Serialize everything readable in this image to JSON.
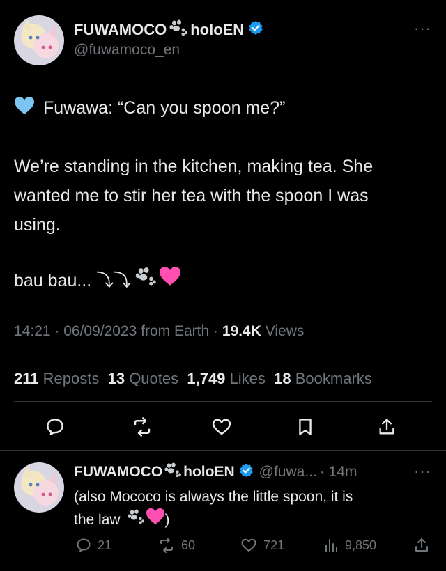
{
  "tweet": {
    "author_name_part1": "FUWAMOCO",
    "author_name_part2": "holoEN",
    "handle": "@fuwamoco_en",
    "more_label": "···",
    "line1": "Fuwawa: “Can you spoon me?”",
    "para2_line1": "We’re standing in the kitchen, making tea. She",
    "para2_line2": "wanted me to stir her tea with the spoon I was",
    "para2_line3": "using.",
    "line4": "bau bau... ⤵⤵",
    "meta_time": "14:21 · 06/09/2023 from Earth · ",
    "meta_views_num": "19.4K",
    "meta_views_label": " Views",
    "stats": [
      {
        "num": "211",
        "label": "Reposts"
      },
      {
        "num": "13",
        "label": "Quotes"
      },
      {
        "num": "1,749",
        "label": "Likes"
      },
      {
        "num": "18",
        "label": "Bookmarks"
      }
    ]
  },
  "reply": {
    "author_name_part1": "FUWAMOCO",
    "author_name_part2": "holoEN",
    "handle": "@fuwa...",
    "time": "· 14m",
    "more_label": "···",
    "text_line1": "(also Mococo is always the little spoon, it is",
    "text_line2_a": "the law",
    "text_line2_b": ")",
    "replies": "21",
    "reposts": "60",
    "likes": "721",
    "views": "9,850"
  },
  "colors": {
    "background": "#000000",
    "text": "#e7e9ea",
    "muted": "#71767b",
    "verified": "#1d9bf0",
    "blue_heart": "#7cc4f2",
    "pink_heart": "#ff4fb0"
  }
}
